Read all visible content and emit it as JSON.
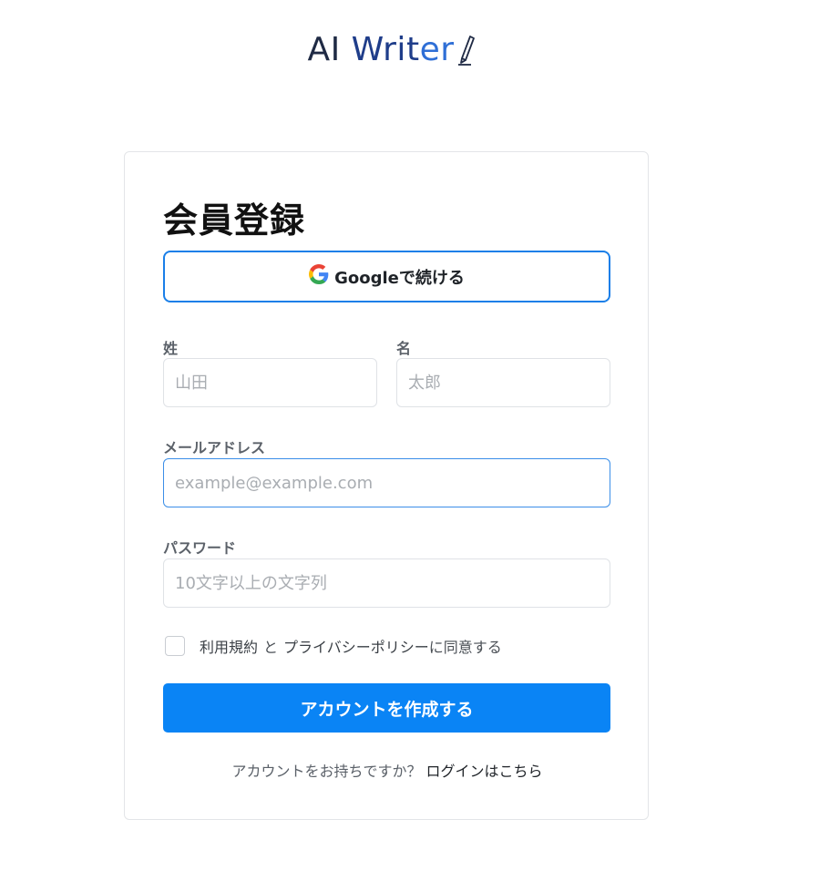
{
  "logo": {
    "part1": "AI ",
    "part2": "Writ",
    "part3": "er"
  },
  "form": {
    "title": "会員登録",
    "google_button": "Googleで続ける",
    "last_name_label": "姓",
    "last_name_placeholder": "山田",
    "first_name_label": "名",
    "first_name_placeholder": "太郎",
    "email_label": "メールアドレス",
    "email_placeholder": "example@example.com",
    "password_label": "パスワード",
    "password_placeholder": "10文字以上の文字列",
    "terms_link": "利用規約",
    "terms_and": "と",
    "privacy_link": "プライバシーポリシー",
    "agree_suffix": "に同意する",
    "submit_button": "アカウントを作成する",
    "have_account_text": "アカウントをお持ちですか？",
    "login_link": "ログインはこちら"
  },
  "colors": {
    "accent": "#0a84f5",
    "focus_border": "#3b8ee8",
    "google_border": "#1a7fe8"
  }
}
